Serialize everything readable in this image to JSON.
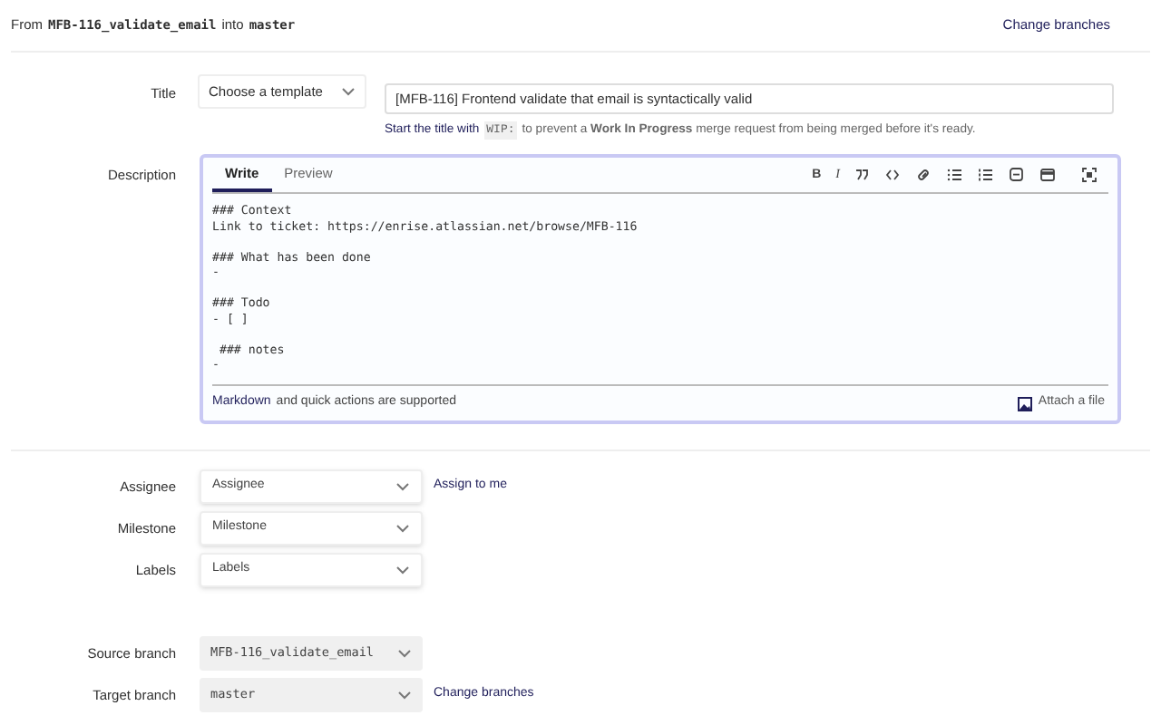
{
  "header": {
    "from": "From",
    "source": "MFB-116_validate_email",
    "into": "into",
    "target": "master",
    "change_link": "Change branches"
  },
  "title_field": {
    "label": "Title",
    "template": "Choose a template",
    "value": "[MFB-116] Frontend validate that email is syntactically valid"
  },
  "title_hint": {
    "link": "Start the title with",
    "code": "WIP:",
    "text": "to prevent a **Work In Progress** merge request from being merged before it's ready."
  },
  "description": {
    "label": "Description",
    "tabs": [
      {
        "label": "Write",
        "selected": true
      },
      {
        "label": "Preview",
        "selected": false
      }
    ],
    "toolbar": {
      "bold": "B",
      "italic": "I"
    },
    "blocks": [
      [
        "### Context",
        "Link to ticket: https://enrise.atlassian.net/browse/MFB-116"
      ],
      [
        "### What has been done",
        "-"
      ],
      [
        "### Todo",
        "- [ ]"
      ],
      [
        " ### notes",
        "-"
      ]
    ],
    "footer_link": "Markdown",
    "footer_text": "and quick actions are supported",
    "attach": "Attach a file"
  },
  "fields": [
    {
      "label": "Assignee",
      "value": "Assignee",
      "link": "Assign to me",
      "mono": false
    },
    {
      "label": "Milestone",
      "value": "Milestone",
      "mono": false
    },
    {
      "label": "Labels",
      "value": "Labels",
      "mono": false
    }
  ],
  "branches": [
    {
      "label": "Source branch",
      "value": "MFB-116_validate_email",
      "mono": true
    },
    {
      "label": "Target branch",
      "value": "master",
      "link": "Change branches",
      "mono": true
    }
  ]
}
